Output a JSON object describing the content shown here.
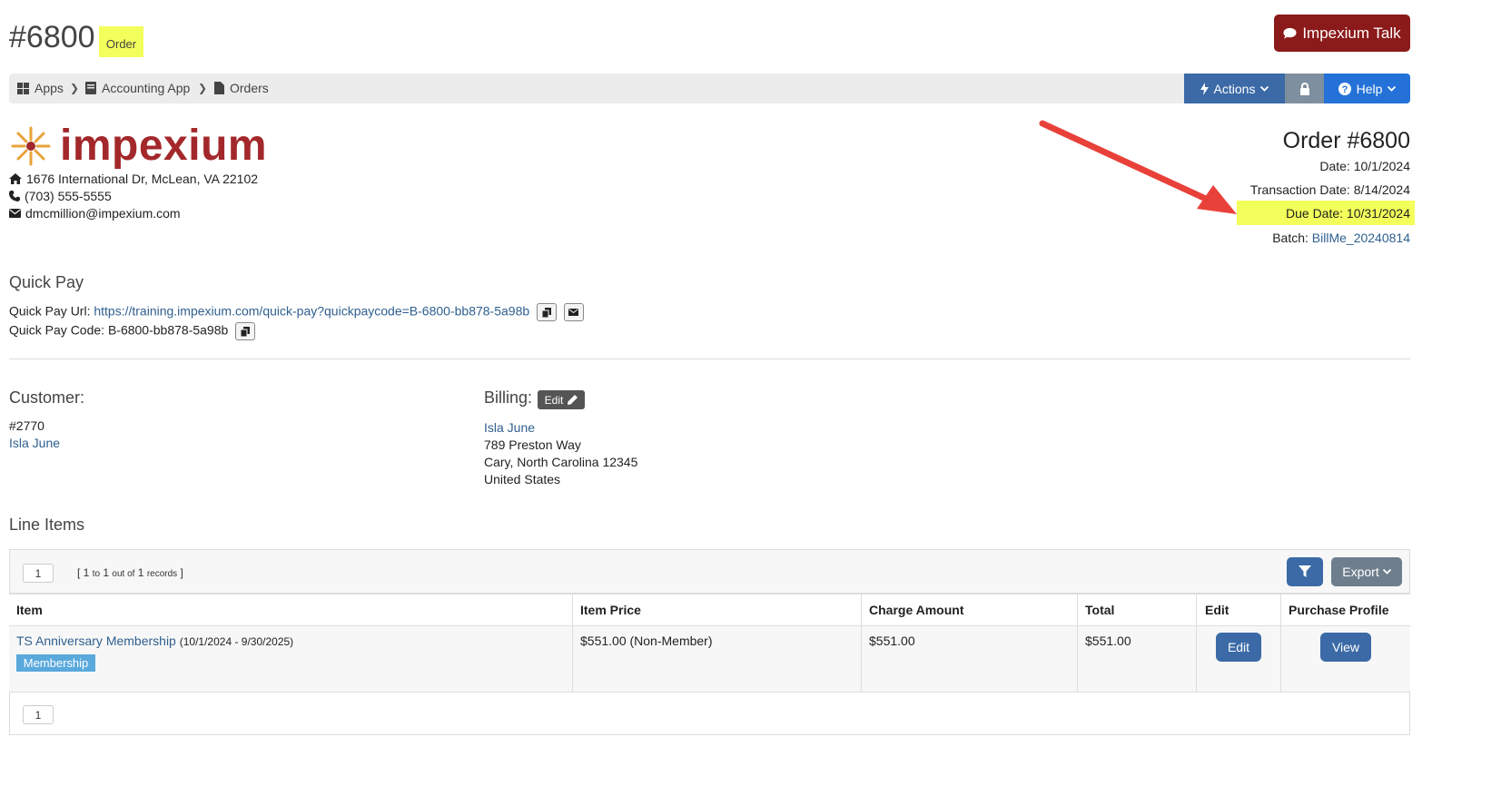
{
  "header": {
    "order_number": "#6800",
    "order_tag": "Order",
    "talk_button": "Impexium Talk"
  },
  "breadcrumb": {
    "items": [
      {
        "label": "Apps",
        "icon": "grid-icon"
      },
      {
        "label": "Accounting App",
        "icon": "book-icon"
      },
      {
        "label": "Orders",
        "icon": "file-icon"
      }
    ],
    "actions_label": "Actions",
    "help_label": "Help"
  },
  "company": {
    "logo_text": "impexium",
    "address": "1676 International Dr, McLean, VA 22102",
    "phone": "(703) 555-5555",
    "email": "dmcmillion@impexium.com"
  },
  "order_info": {
    "title": "Order #6800",
    "date": "Date: 10/1/2024",
    "transaction_date": "Transaction Date: 8/14/2024",
    "due_date": "Due Date: 10/31/2024",
    "batch_label": "Batch:",
    "batch_value": "BillMe_20240814"
  },
  "quick_pay": {
    "title": "Quick Pay",
    "url_label": "Quick Pay Url:",
    "url_value": "https://training.impexium.com/quick-pay?quickpaycode=B-6800-bb878-5a98b",
    "code_label": "Quick Pay Code:",
    "code_value": "B-6800-bb878-5a98b"
  },
  "customer": {
    "title": "Customer:",
    "id": "#2770",
    "name": "Isla June"
  },
  "billing": {
    "title": "Billing:",
    "edit_label": "Edit",
    "name": "Isla June",
    "street": "789 Preston Way",
    "city": "Cary, North Carolina 12345",
    "country": "United States"
  },
  "line_items": {
    "title": "Line Items",
    "page": "1",
    "records": {
      "from": "1",
      "to_word": "to",
      "to": "1",
      "outof_word": "out of",
      "total": "1",
      "records_word": "records"
    },
    "export_label": "Export",
    "columns": [
      "Item",
      "Item Price",
      "Charge Amount",
      "Total",
      "Edit",
      "Purchase Profile"
    ],
    "rows": [
      {
        "item": "TS Anniversary Membership",
        "period": "(10/1/2024 - 9/30/2025)",
        "badge": "Membership",
        "item_price": "$551.00 (Non-Member)",
        "charge_amount": "$551.00",
        "total": "$551.00",
        "edit_label": "Edit",
        "view_label": "View"
      }
    ],
    "bottom_page": "1"
  },
  "colors": {
    "highlight": "#f3ff5a",
    "brand_red": "#8b1a1a",
    "primary_blue": "#3b6aa6",
    "arrow": "#e8413a"
  }
}
